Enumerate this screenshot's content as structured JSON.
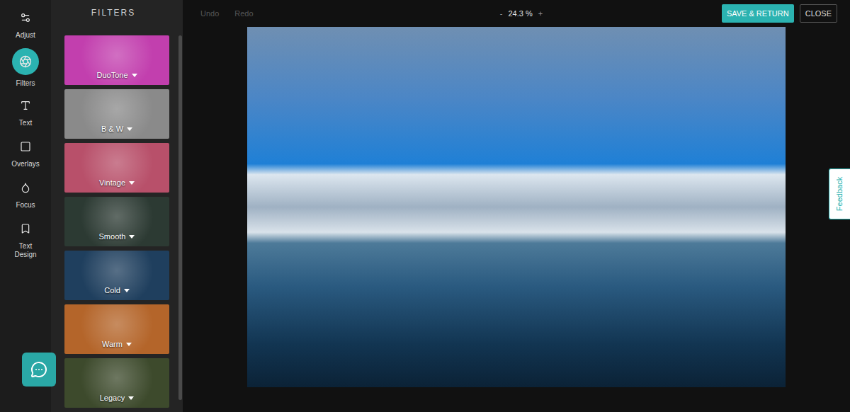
{
  "rail": [
    {
      "label": "Adjust",
      "selected": false
    },
    {
      "label": "Filters",
      "selected": true
    },
    {
      "label": "Text",
      "selected": false
    },
    {
      "label": "Overlays",
      "selected": false
    },
    {
      "label": "Focus",
      "selected": false
    },
    {
      "label": "Text Design",
      "selected": false
    }
  ],
  "panel": {
    "title": "FILTERS",
    "filters": [
      {
        "label": "DuoTone",
        "color": "#c23fae"
      },
      {
        "label": "B & W",
        "color": "#8a8a8a"
      },
      {
        "label": "Vintage",
        "color": "#b8506a"
      },
      {
        "label": "Smooth",
        "color": "#2c3a33"
      },
      {
        "label": "Cold",
        "color": "#1f3f5e"
      },
      {
        "label": "Warm",
        "color": "#b4652a"
      },
      {
        "label": "Legacy",
        "color": "#3d4a2c"
      }
    ]
  },
  "toolbar": {
    "undo": {
      "label": "Undo",
      "disabled": true
    },
    "redo": {
      "label": "Redo",
      "disabled": true
    },
    "zoom": {
      "minus": "-",
      "value": "24.3 %",
      "plus": "+"
    },
    "save": "SAVE & RETURN",
    "close": "CLOSE"
  },
  "feedback": "Feedback"
}
